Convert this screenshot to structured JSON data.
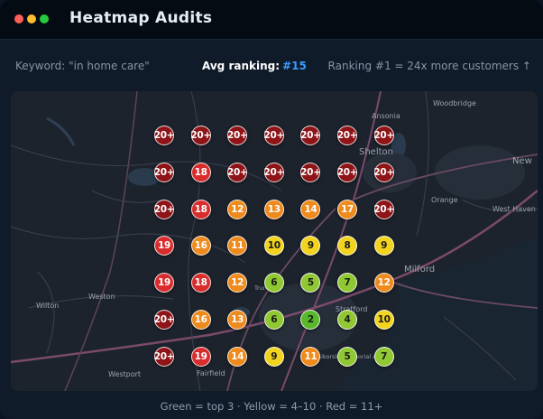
{
  "window": {
    "title": "Heatmap Audits"
  },
  "info": {
    "keyword": "Keyword: \"in home care\"",
    "avg_label": "Avg ranking:",
    "avg_value": "#15",
    "rank_note": "Ranking #1 = 24x more customers ↑"
  },
  "legend": "Green = top 3  ·  Yellow = 4–10  ·  Red = 11+",
  "colors": {
    "accent": "#3b9bff",
    "green": "#58b82a",
    "light_green": "#8fc832",
    "yellow": "#f2d41e",
    "orange": "#ef8a1c",
    "red": "#d92d2d",
    "dark_red": "#8e1418"
  },
  "map_labels": [
    "Woodbridge",
    "Ansonia",
    "Shelton",
    "Orange",
    "New",
    "West Haven",
    "Milford",
    "Weston",
    "Wilton",
    "Fairfield",
    "Westport",
    "Stratford",
    "Sikorsky Memorial Airport",
    "Trumbull"
  ],
  "grid": [
    [
      "20+",
      "20+",
      "20+",
      "20+",
      "20+",
      "20+",
      "20+"
    ],
    [
      "20+",
      "18",
      "20+",
      "20+",
      "20+",
      "20+",
      "20+"
    ],
    [
      "20+",
      "18",
      "12",
      "13",
      "14",
      "17",
      "20+"
    ],
    [
      "19",
      "16",
      "11",
      "10",
      "9",
      "8",
      "9"
    ],
    [
      "19",
      "18",
      "12",
      "6",
      "5",
      "7",
      "12"
    ],
    [
      "20+",
      "16",
      "13",
      "6",
      "2",
      "4",
      "10"
    ],
    [
      "20+",
      "19",
      "14",
      "9",
      "11",
      "5",
      "7"
    ]
  ]
}
